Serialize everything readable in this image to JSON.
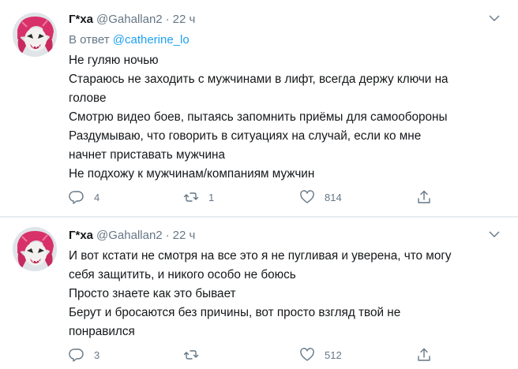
{
  "tweets": [
    {
      "name": "Г*ха",
      "handle": "@Gahallan2",
      "separator": "·",
      "time": "22 ч",
      "reply_prefix": "В ответ",
      "reply_handle": "@catherine_lo",
      "lines": [
        "Не гуляю ночью",
        "Стараюсь не заходить с мужчинами в лифт,  всегда держу ключи на",
        "голове",
        "Смотрю видео боев, пытаясь запомнить приёмы для самообороны",
        "Раздумываю, что говорить в ситуациях на случай, если ко мне",
        "начнет приставать мужчина",
        "Не подхожу к мужчинам/компаниям мужчин"
      ],
      "replies": "4",
      "retweets": "1",
      "likes": "814"
    },
    {
      "name": "Г*ха",
      "handle": "@Gahallan2",
      "separator": "·",
      "time": "22 ч",
      "lines": [
        "И вот кстати не смотря на все это я не пугливая и уверена, что могу",
        "себя защитить, и никого особо не боюсь",
        "Просто знаете как это бывает",
        "Берут и бросаются без причины, вот просто взгляд твой не",
        "понравился"
      ],
      "replies": "3",
      "retweets": "",
      "likes": "512"
    }
  ],
  "icons": {
    "reply": "reply-icon",
    "retweet": "retweet-icon",
    "like": "heart-icon",
    "share": "share-icon",
    "menu": "chevron-down-icon"
  },
  "colors": {
    "text": "#14171a",
    "secondary": "#657786",
    "link": "#1da1f2",
    "divider": "#e6ecf0"
  }
}
